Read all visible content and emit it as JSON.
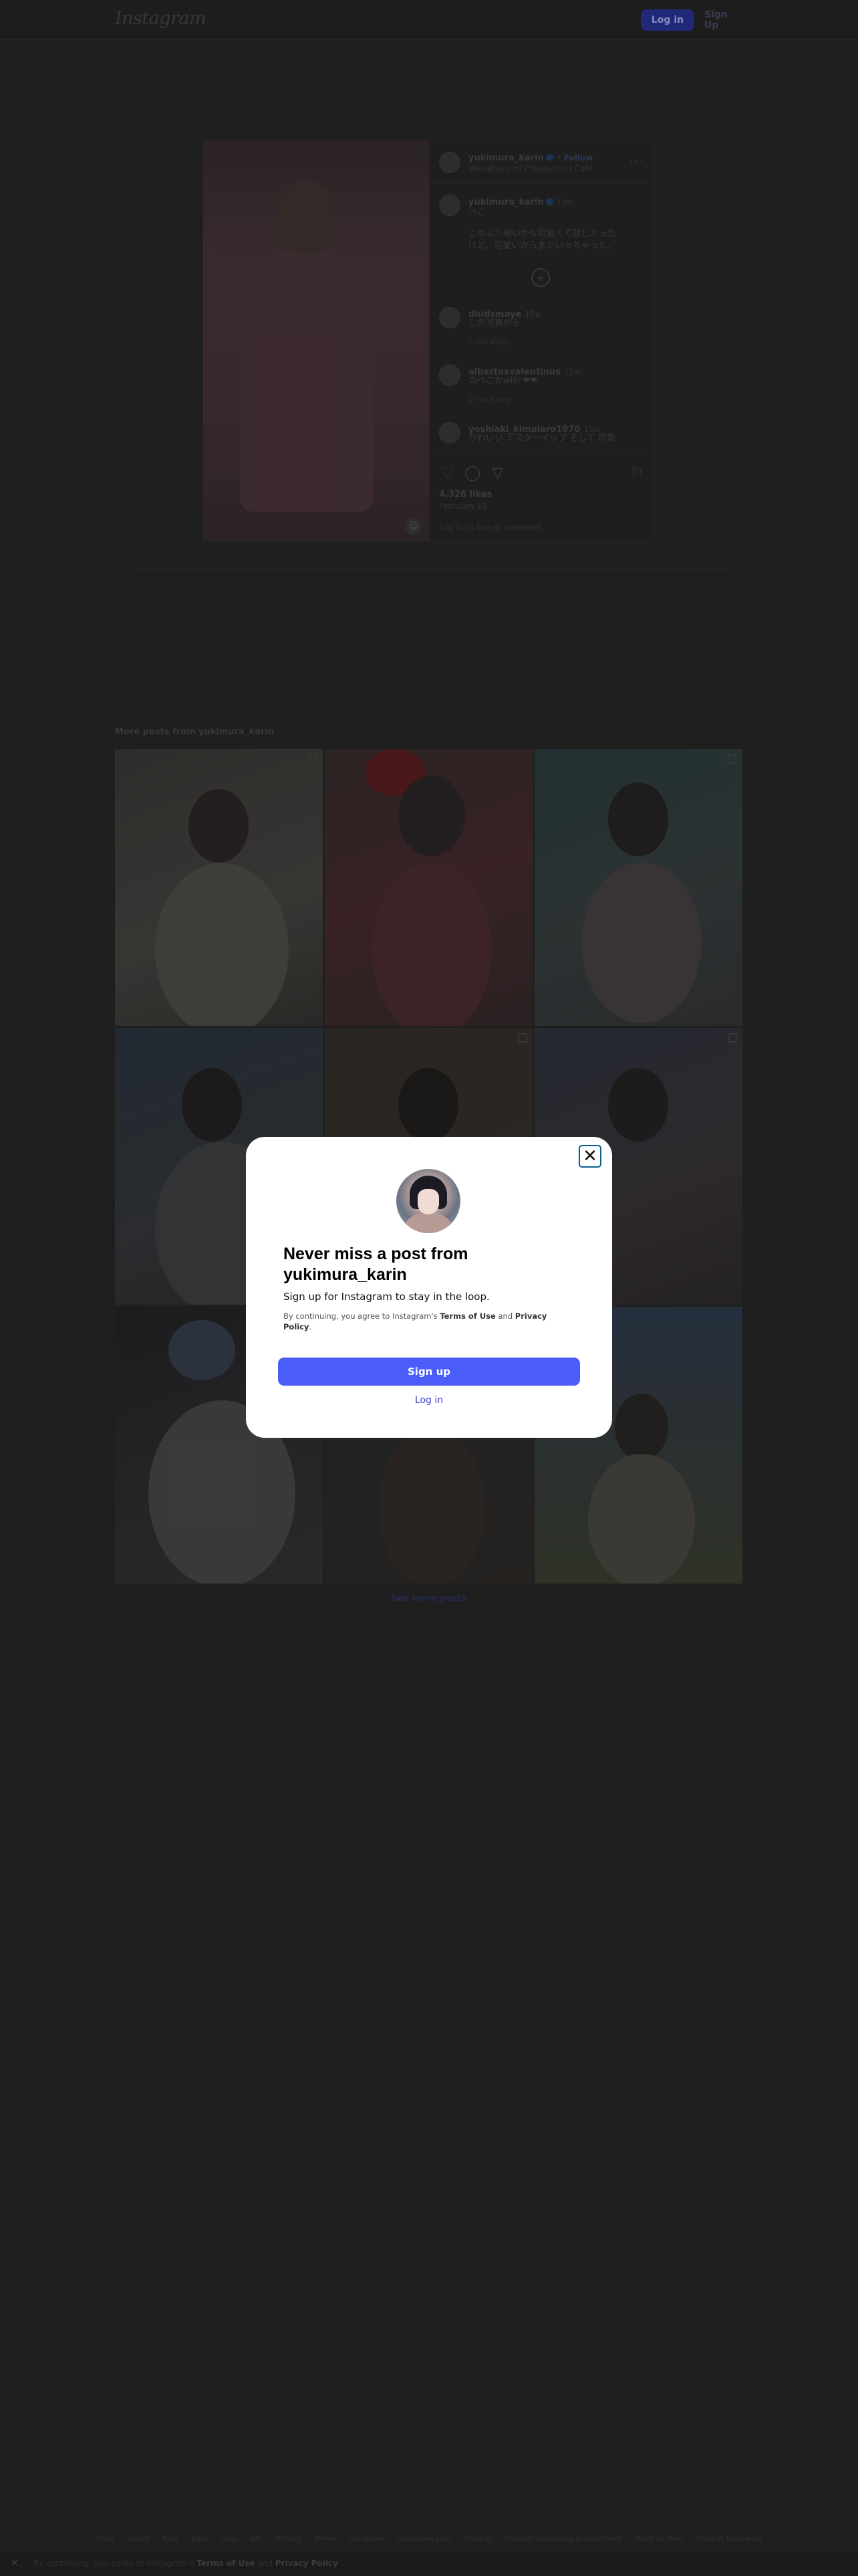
{
  "header": {
    "logo_text": "Instagram",
    "login_label": "Log in",
    "signup_label": "Sign Up"
  },
  "post": {
    "author": "yukimura_karin",
    "follow_label": "Follow",
    "location": "Wakabayashi Chikatetsu / Cafe",
    "caption_author": "yukimura_karin",
    "caption_time": "15w",
    "caption_lines": [
      "ぺこ",
      "",
      "このふり袖いかな可愛くて寂しかった",
      "けど、可愛いからまたいっちゃった。"
    ],
    "comments": [
      {
        "user": "dhidsmaye",
        "time": "15w",
        "text": "この写真がを",
        "reply": "1 like  Reply"
      },
      {
        "user": "albertoxvalentinus",
        "time": "15w",
        "text": "のぺこかwiki ❤❤",
        "reply": "1 like  Reply"
      },
      {
        "user": "yoshiaki_kimalaro1970",
        "time": "15w",
        "text": "かわいい ミスターイップ そして 可愛"
      }
    ],
    "likes": "4,326 likes",
    "date": "February 19",
    "login_prompt": "Log in to like or comment."
  },
  "more_posts": {
    "title": "More posts from yukimura_karin",
    "see_more": "See more posts"
  },
  "footer": {
    "links": [
      "Meta",
      "About",
      "Blog",
      "Jobs",
      "Help",
      "API",
      "Privacy",
      "Terms",
      "Locations",
      "Instagram Lite",
      "Threads",
      "Contact Uploading & Non-Users",
      "Meta Verified",
      "Meta in Indonesia"
    ],
    "cookie_prefix": "By continuing, you agree to Instagram's",
    "cookie_terms": "Terms of Use",
    "cookie_and": "and",
    "cookie_privacy": "Privacy Policy",
    "cookie_close": "✕"
  },
  "modal": {
    "title": "Never miss a post from yukimura_karin",
    "subtitle": "Sign up for Instagram to stay in the loop.",
    "terms_prefix": "By continuing, you agree to Instagram's",
    "terms_link": "Terms of Use",
    "terms_and": "and",
    "privacy_link": "Privacy Policy",
    "terms_suffix": ".",
    "signup_label": "Sign up",
    "login_label": "Log in",
    "close_symbol": "✕"
  },
  "colors": {
    "page_bg": "#202020",
    "primary_button": "#4a5df9",
    "modal_bg": "#ffffff"
  }
}
